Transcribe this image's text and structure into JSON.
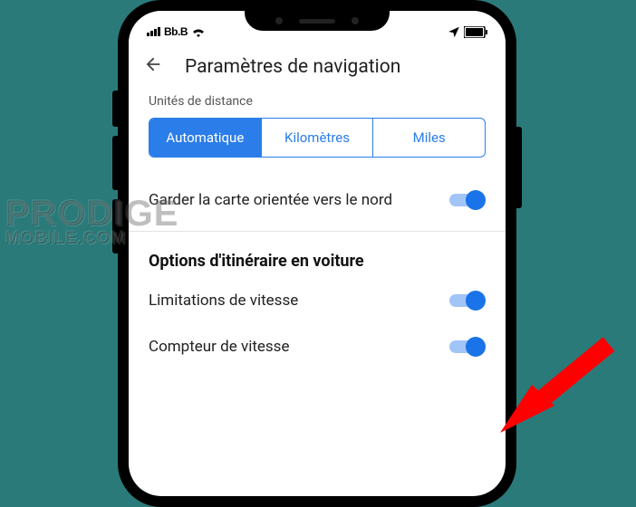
{
  "statusbar": {
    "carrier": "Bb.B"
  },
  "header": {
    "title": "Paramètres de navigation"
  },
  "distance_units": {
    "label": "Unités de distance",
    "options": [
      "Automatique",
      "Kilomètres",
      "Miles"
    ],
    "selected_index": 0
  },
  "settings": {
    "keep_map_north": {
      "label": "Garder la carte orientée vers le nord",
      "value": true
    }
  },
  "driving_section": {
    "title": "Options d'itinéraire en voiture",
    "speed_limits": {
      "label": "Limitations de vitesse",
      "value": true
    },
    "speedometer": {
      "label": "Compteur de vitesse",
      "value": true
    }
  },
  "watermark": {
    "line1": "PRODIGE",
    "line2": "MOBILE.COM"
  }
}
